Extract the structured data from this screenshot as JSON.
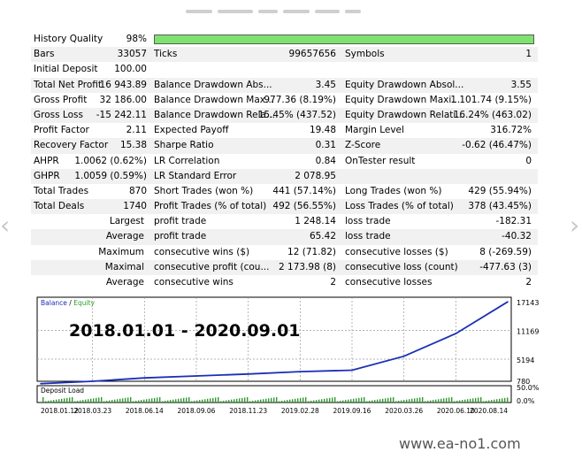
{
  "report": {
    "rows": [
      {
        "cells": [
          {
            "label": "History Quality",
            "value": "98%"
          }
        ],
        "quality_fraction": 0.98
      },
      {
        "cells": [
          {
            "label": "Bars",
            "value": "33057"
          },
          {
            "label": "Ticks",
            "value": "99657656"
          },
          {
            "label": "Symbols",
            "value": "1"
          }
        ]
      },
      {
        "cells": [
          {
            "label": "Initial Deposit",
            "value": "100.00"
          }
        ]
      },
      {
        "cells": [
          {
            "label": "Total Net Profit",
            "value": "16 943.89"
          },
          {
            "label": "Balance Drawdown Abs...",
            "value": "3.45"
          },
          {
            "label": "Equity Drawdown Absol...",
            "value": "3.55"
          }
        ]
      },
      {
        "cells": [
          {
            "label": "Gross Profit",
            "value": "32 186.00"
          },
          {
            "label": "Balance Drawdown Max...",
            "value": "977.36 (8.19%)"
          },
          {
            "label": "Equity Drawdown Maxi...",
            "value": "1 101.74 (9.15%)"
          }
        ]
      },
      {
        "cells": [
          {
            "label": "Gross Loss",
            "value": "-15 242.11"
          },
          {
            "label": "Balance Drawdown Rela...",
            "value": "15.45% (437.52)"
          },
          {
            "label": "Equity Drawdown Relati...",
            "value": "16.24% (463.02)"
          }
        ]
      },
      {
        "cells": [
          {
            "label": "Profit Factor",
            "value": "2.11"
          },
          {
            "label": "Expected Payoff",
            "value": "19.48"
          },
          {
            "label": "Margin Level",
            "value": "316.72%"
          }
        ]
      },
      {
        "cells": [
          {
            "label": "Recovery Factor",
            "value": "15.38"
          },
          {
            "label": "Sharpe Ratio",
            "value": "0.31"
          },
          {
            "label": "Z-Score",
            "value": "-0.62 (46.47%)"
          }
        ]
      },
      {
        "cells": [
          {
            "label": "AHPR",
            "value": "1.0062 (0.62%)"
          },
          {
            "label": "LR Correlation",
            "value": "0.84"
          },
          {
            "label": "OnTester result",
            "value": "0"
          }
        ]
      },
      {
        "cells": [
          {
            "label": "GHPR",
            "value": "1.0059 (0.59%)"
          },
          {
            "label": "LR Standard Error",
            "value": "2 078.95"
          }
        ]
      },
      {
        "cells": [
          {
            "label": "Total Trades",
            "value": "870"
          },
          {
            "label": "Short Trades (won %)",
            "value": "441 (57.14%)"
          },
          {
            "label": "Long Trades (won %)",
            "value": "429 (55.94%)"
          }
        ]
      },
      {
        "cells": [
          {
            "label": "Total Deals",
            "value": "1740"
          },
          {
            "label": "Profit Trades (% of total)",
            "value": "492 (56.55%)"
          },
          {
            "label": "Loss Trades (% of total)",
            "value": "378 (43.45%)"
          }
        ]
      },
      {
        "cells": [
          {
            "label": "Largest",
            "value": ""
          },
          {
            "label": "profit trade",
            "value": "1 248.14"
          },
          {
            "label": "loss trade",
            "value": "-182.31"
          }
        ]
      },
      {
        "cells": [
          {
            "label": "Average",
            "value": ""
          },
          {
            "label": "profit trade",
            "value": "65.42"
          },
          {
            "label": "loss trade",
            "value": "-40.32"
          }
        ]
      },
      {
        "cells": [
          {
            "label": "Maximum",
            "value": ""
          },
          {
            "label": "consecutive wins ($)",
            "value": "12 (71.82)"
          },
          {
            "label": "consecutive losses ($)",
            "value": "8 (-269.59)"
          }
        ]
      },
      {
        "cells": [
          {
            "label": "Maximal",
            "value": ""
          },
          {
            "label": "consecutive profit (cou...",
            "value": "2 173.98 (8)"
          },
          {
            "label": "consecutive loss (count)",
            "value": "-477.63 (3)"
          }
        ]
      },
      {
        "cells": [
          {
            "label": "Average",
            "value": ""
          },
          {
            "label": "consecutive wins",
            "value": "2"
          },
          {
            "label": "consecutive losses",
            "value": "2"
          }
        ]
      }
    ]
  },
  "chart": {
    "legend_balance": "Balance",
    "legend_sep": " / ",
    "legend_equity": "Equity",
    "overlay_text": "2018.01.01 - 2020.09.01",
    "y_ticks": [
      "17143",
      "11169",
      "5194",
      "780"
    ],
    "deposit_label": "Deposit Load",
    "deposit_ticks": [
      "50.0%",
      "0.0%"
    ],
    "x_ticks": [
      "2018.01.12",
      "2018.03.23",
      "2018.06.14",
      "2018.09.06",
      "2018.11.23",
      "2019.02.28",
      "2019.09.16",
      "2020.03.26",
      "2020.06.10",
      "2020.08.14"
    ],
    "colors": {
      "balance": "#1a2fb5",
      "equity": "#2e9b2e",
      "deposit": "#2e9b2e",
      "frame": "#000000",
      "grid": "#9a9a9a"
    }
  },
  "chart_data": {
    "type": "line",
    "title": "",
    "xlabel": "",
    "ylabel": "",
    "x": [
      "2018.01.12",
      "2018.03.23",
      "2018.06.14",
      "2018.09.06",
      "2018.11.23",
      "2019.02.28",
      "2019.09.16",
      "2020.03.26",
      "2020.06.10",
      "2020.08.14"
    ],
    "series": [
      {
        "name": "Balance",
        "values": [
          100,
          600,
          1300,
          1700,
          2100,
          2600,
          2900,
          5800,
          10500,
          17100
        ]
      }
    ],
    "ylim": [
      780,
      17143
    ],
    "grid": true
  },
  "footer": {
    "watermark": "www.ea-no1.com"
  }
}
